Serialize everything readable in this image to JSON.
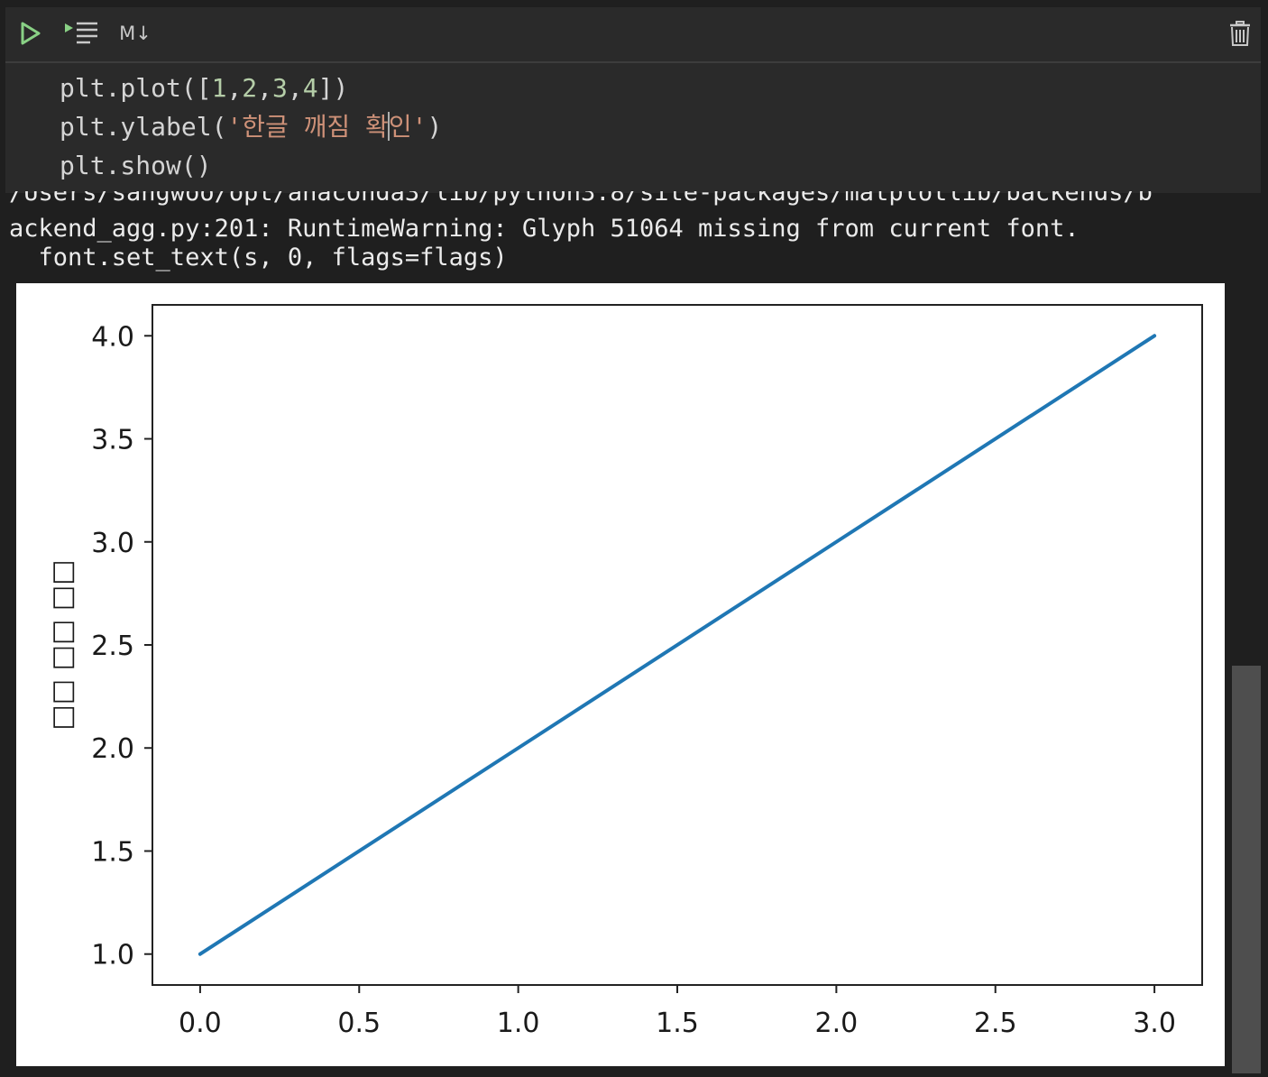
{
  "toolbar": {
    "markdown_label": "M↓"
  },
  "code": {
    "line1": {
      "p1": "plt.plot([",
      "n1": "1",
      "c1": ",",
      "n2": "2",
      "c2": ",",
      "n3": "3",
      "c3": ",",
      "n4": "4",
      "p2": "])"
    },
    "line2": {
      "p1": "plt.ylabel(",
      "s1": "'한글 깨짐 확",
      "s2": "인'",
      "p2": ")"
    },
    "line3": "plt.show()"
  },
  "output": {
    "line0": "/Users/sangwoo/opt/anaconda3/lib/python3.8/site-packages/matplotlib/backends/b",
    "line1": "ackend_agg.py:201: RuntimeWarning: Glyph 51064 missing from current font.",
    "line2": "  font.set_text(s, 0, flags=flags)"
  },
  "chart_data": {
    "type": "line",
    "x": [
      0,
      1,
      2,
      3
    ],
    "series": [
      {
        "values": [
          1,
          2,
          3,
          4
        ],
        "color": "#1f77b4"
      }
    ],
    "xlim": [
      -0.15,
      3.15
    ],
    "ylim": [
      0.85,
      4.15
    ],
    "xticks": [
      "0.0",
      "0.5",
      "1.0",
      "1.5",
      "2.0",
      "2.5",
      "3.0"
    ],
    "yticks": [
      "1.0",
      "1.5",
      "2.0",
      "2.5",
      "3.0",
      "3.5",
      "4.0"
    ],
    "ylabel": "□□ □□ □□",
    "grid": false
  },
  "colors": {
    "run_icon": "#89d185",
    "number": "#b5cea8",
    "string": "#ce9178"
  }
}
